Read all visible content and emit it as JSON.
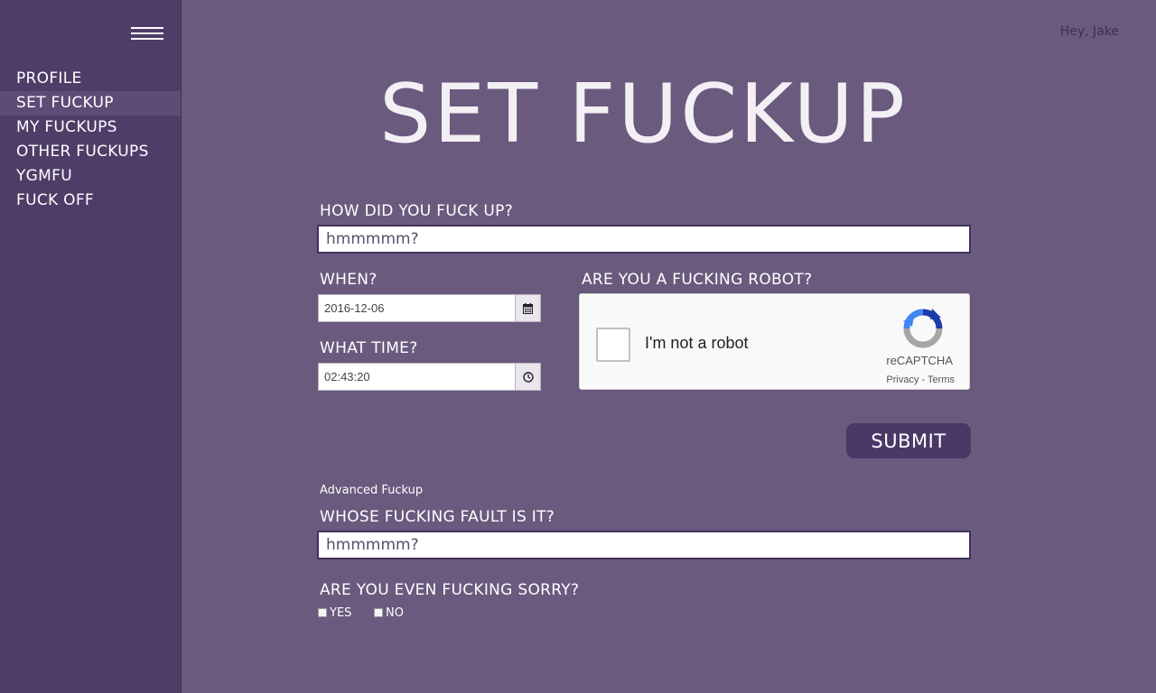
{
  "sidebar": {
    "items": [
      {
        "label": "PROFILE"
      },
      {
        "label": "SET FUCKUP"
      },
      {
        "label": "MY FUCKUPS"
      },
      {
        "label": "OTHER FUCKUPS"
      },
      {
        "label": "YGMFU"
      },
      {
        "label": "FUCK OFF"
      }
    ],
    "active_item": "SET FUCKUP"
  },
  "header": {
    "greeting": "Hey, Jake",
    "title": "SET FUCKUP"
  },
  "form": {
    "how_label": "HOW DID YOU FUCK UP?",
    "how_placeholder": "hmmmmm?",
    "when_label": "WHEN?",
    "when_value": "2016-12-06",
    "time_label": "WHAT TIME?",
    "time_value": "02:43:20",
    "robot_label": "ARE YOU A FUCKING ROBOT?",
    "submit_label": "SUBMIT"
  },
  "captcha": {
    "label": "I'm not a robot",
    "brand": "reCAPTCHA",
    "links": "Privacy - Terms"
  },
  "advanced": {
    "toggle_label": "Advanced Fuckup",
    "fault_label": "WHOSE FUCKING FAULT IS IT?",
    "fault_placeholder": "hmmmmm?",
    "sorry_label": "ARE YOU EVEN FUCKING SORRY?",
    "yes_label": "YES",
    "no_label": "NO"
  },
  "icons": [
    "hamburger-menu-icon",
    "calendar-icon",
    "clock-icon",
    "recaptcha-logo-icon"
  ],
  "colors": {
    "background": "#6a5a7e",
    "sidebar": "#4f3d68",
    "sidebar_active": "#5e4b76",
    "button": "#4a3966"
  }
}
